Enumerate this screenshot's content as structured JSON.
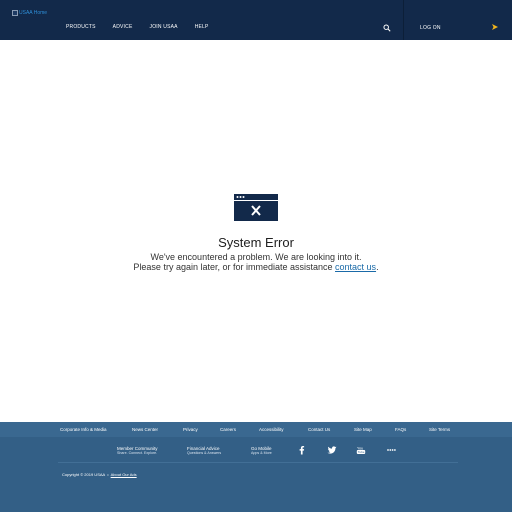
{
  "header": {
    "logo_alt": "USAA Home",
    "nav": [
      "PRODUCTS",
      "ADVICE",
      "JOIN USAA",
      "HELP"
    ],
    "logon_label": "LOG ON"
  },
  "error": {
    "title": "System Error",
    "line1": "We've encountered a problem. We are looking into it.",
    "line2_text": "Please try again later, or for immediate assistance ",
    "link": "contact us",
    "line2_end": "."
  },
  "footer": {
    "links": [
      "Corporate Info & Media",
      "News Center",
      "Privacy",
      "Careers",
      "Accessibility",
      "Contact Us",
      "Site Map",
      "FAQs",
      "Site Terms"
    ],
    "community_title": "Member Community",
    "community_sub": "Share. Connect. Explore.",
    "advice_title": "Financial Advice",
    "advice_sub": "Questions & Answers",
    "mobile_title": "Go Mobile",
    "mobile_sub": "Apps & More",
    "social_icons": [
      "facebook-icon",
      "twitter-icon",
      "youtube-icon",
      "more-icon"
    ],
    "copyright": "Copyright © 2019 USAA",
    "about_ads": "About Our Ads"
  },
  "colors": {
    "header_bg": "#12294a",
    "footer_bg": "#335f86",
    "link": "#1a6aa8",
    "accent_chevron": "#f2b51c"
  }
}
